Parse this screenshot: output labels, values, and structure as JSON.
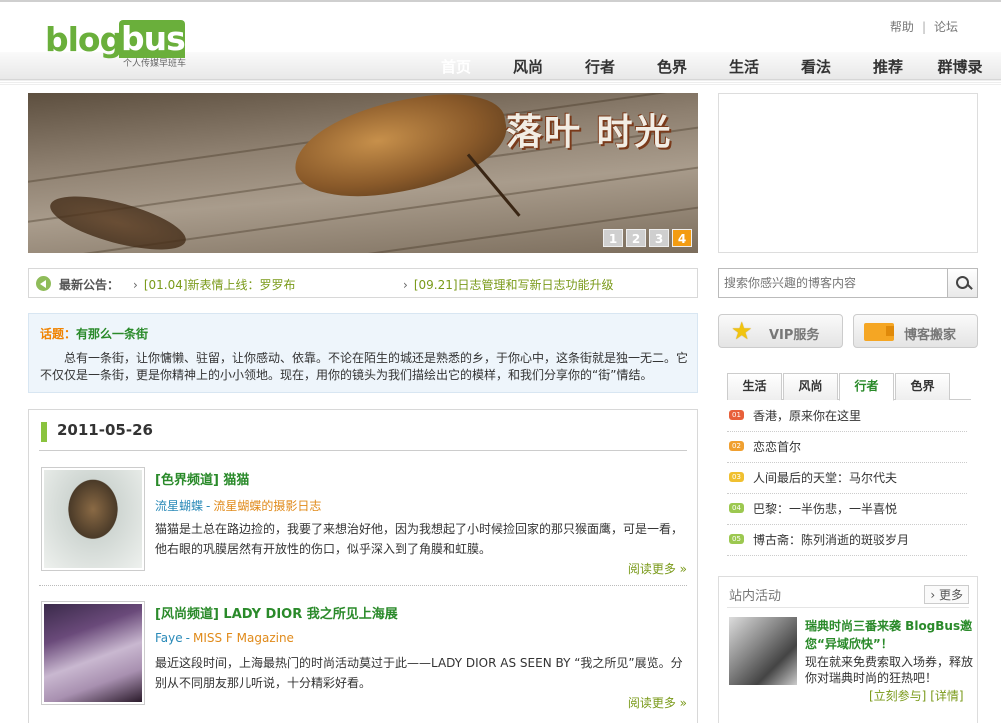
{
  "header": {
    "logo_main": "blog",
    "logo_accent": "bus",
    "logo_slogan": "个人传媒早班车",
    "top_links": [
      "帮助",
      "论坛"
    ],
    "top_sep": "|",
    "nav": [
      {
        "label": "首页",
        "active": true
      },
      {
        "label": "风尚",
        "active": false
      },
      {
        "label": "行者",
        "active": false
      },
      {
        "label": "色界",
        "active": false
      },
      {
        "label": "生活",
        "active": false
      },
      {
        "label": "看法",
        "active": false
      },
      {
        "label": "推荐",
        "active": false
      },
      {
        "label": "群博录",
        "active": false
      }
    ]
  },
  "banner": {
    "title": "落叶 时光",
    "pages": [
      "1",
      "2",
      "3",
      "4"
    ],
    "active_page": 4
  },
  "notice": {
    "label": "最新公告：",
    "items": [
      "[01.04]新表情上线：罗罗布",
      "[09.21]日志管理和写新日志功能升级"
    ]
  },
  "topic": {
    "label": "话题：",
    "title": "有那么一条街",
    "body": "总有一条街，让你慵懒、驻留，让你感动、依靠。不论在陌生的城还是熟悉的乡，于你心中，这条街就是独一无二。它不仅仅是一条街，更是你精神上的小小领地。现在，用你的镜头为我们描绘出它的模样，和我们分享你的“街”情结。"
  },
  "posts_section": {
    "date": "2011-05-26",
    "posts": [
      {
        "title": "[色界频道] 猫猫",
        "author": "流星蝴蝶",
        "sep": "-",
        "blog": "流星蝴蝶的摄影日志",
        "summary": "猫猫是土总在路边捡的，我要了来想治好他，因为我想起了小时候捡回家的那只猴面鹰，可是一看，他右眼的巩膜居然有开放性的伤口，似乎深入到了角膜和虹膜。",
        "more": "阅读更多"
      },
      {
        "title": "[风尚频道] LADY DIOR 我之所见上海展",
        "author": "Faye",
        "sep": "-",
        "blog": "MISS F Magazine",
        "summary": "最近这段时间，上海最热门的时尚活动莫过于此——LADY DIOR AS SEEN BY “我之所见”展览。分别从不同朋友那儿听说，十分精彩好看。",
        "more": "阅读更多"
      }
    ]
  },
  "sidebar": {
    "search_placeholder": "搜索你感兴趣的博客内容",
    "vip_label": "VIP服务",
    "move_label": "博客搬家",
    "tabs": [
      {
        "label": "生活",
        "active": false
      },
      {
        "label": "风尚",
        "active": false
      },
      {
        "label": "行者",
        "active": true
      },
      {
        "label": "色界",
        "active": false
      }
    ],
    "ranks": [
      {
        "num": "01",
        "text": "香港，原来你在这里",
        "color": "#e8603a"
      },
      {
        "num": "02",
        "text": "恋恋首尔",
        "color": "#f0a030"
      },
      {
        "num": "03",
        "text": "人间最后的天堂：马尔代夫",
        "color": "#f0c030"
      },
      {
        "num": "04",
        "text": "巴黎：一半伤悲，一半喜悦",
        "color": "#9cc850"
      },
      {
        "num": "05",
        "text": "博古斋：陈列消逝的斑驳岁月",
        "color": "#9cc850"
      }
    ],
    "event": {
      "heading": "站内活动",
      "more": "更多",
      "title": "瑞典时尚三番来袭 BlogBus邀您“异域欣快”！",
      "desc": "现在就来免费索取入场券，释放你对瑞典时尚的狂热吧！",
      "join": "[立刻参与]",
      "detail": "[详情]"
    }
  }
}
